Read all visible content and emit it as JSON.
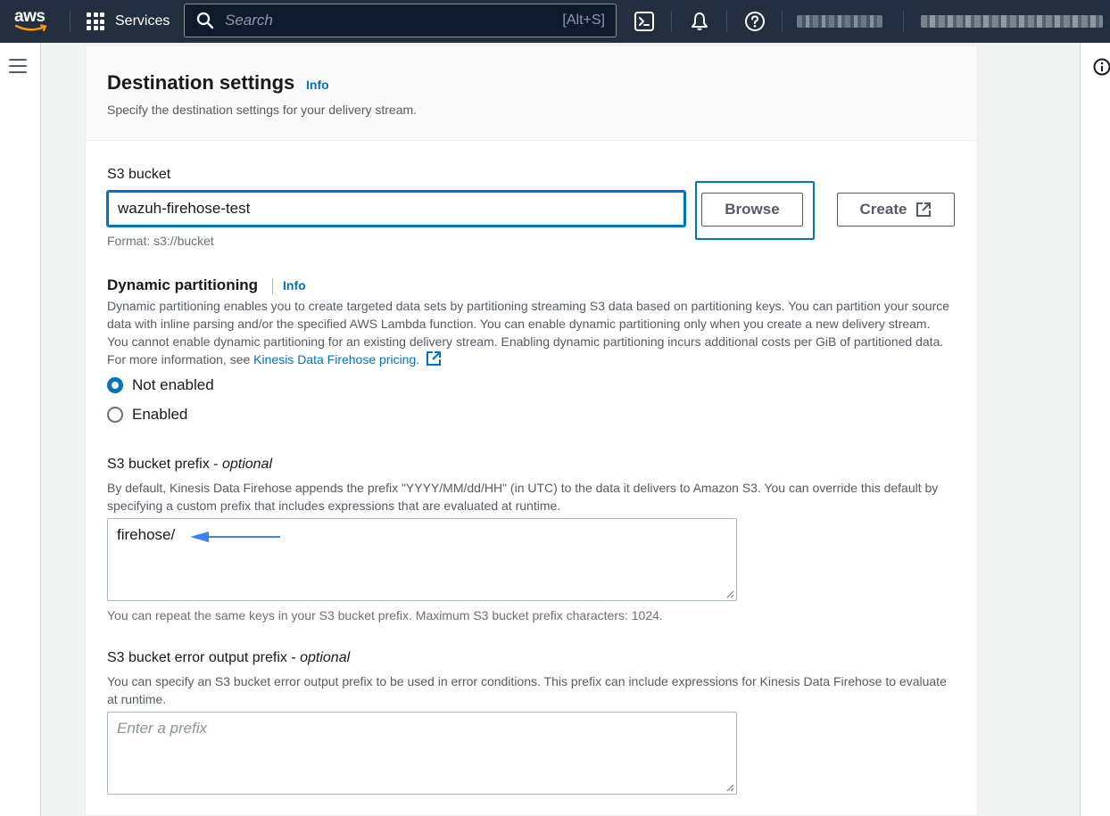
{
  "topnav": {
    "logo_text": "aws",
    "services_label": "Services",
    "search_placeholder": "Search",
    "search_shortcut": "[Alt+S]",
    "icons": [
      "cloudshell-icon",
      "bell-icon",
      "help-icon"
    ]
  },
  "section": {
    "title": "Destination settings",
    "info_label": "Info",
    "description": "Specify the destination settings for your delivery stream."
  },
  "s3_bucket": {
    "label": "S3 bucket",
    "value": "wazuh-firehose-test",
    "format_hint": "Format: s3://bucket",
    "browse_label": "Browse",
    "create_label": "Create"
  },
  "dynamic_partitioning": {
    "label": "Dynamic partitioning",
    "info_label": "Info",
    "description": "Dynamic partitioning enables you to create targeted data sets by partitioning streaming S3 data based on partitioning keys. You can partition your source data with inline parsing and/or the specified AWS Lambda function. You can enable dynamic partitioning only when you create a new delivery stream. You cannot enable dynamic partitioning for an existing delivery stream. Enabling dynamic partitioning incurs additional costs per GiB of partitioned data. For more information, see ",
    "pricing_link": "Kinesis Data Firehose pricing.",
    "options": [
      {
        "label": "Not enabled",
        "selected": true
      },
      {
        "label": "Enabled",
        "selected": false
      }
    ]
  },
  "s3_prefix": {
    "label": "S3 bucket prefix - ",
    "optional": "optional",
    "description": "By default, Kinesis Data Firehose appends the prefix \"YYYY/MM/dd/HH\" (in UTC) to the data it delivers to Amazon S3. You can override this default by specifying a custom prefix that includes expressions that are evaluated at runtime.",
    "value": "firehose/",
    "hint": "You can repeat the same keys in your S3 bucket prefix. Maximum S3 bucket prefix characters: 1024."
  },
  "s3_error_prefix": {
    "label": "S3 bucket error output prefix - ",
    "optional": "optional",
    "description": "You can specify an S3 bucket error output prefix to be used in error conditions. This prefix can include expressions for Kinesis Data Firehose to evaluate at runtime.",
    "placeholder": "Enter a prefix"
  },
  "colors": {
    "nav_bg": "#232f3e",
    "link": "#0073bb",
    "annotation_arrow": "#3b82f6"
  }
}
